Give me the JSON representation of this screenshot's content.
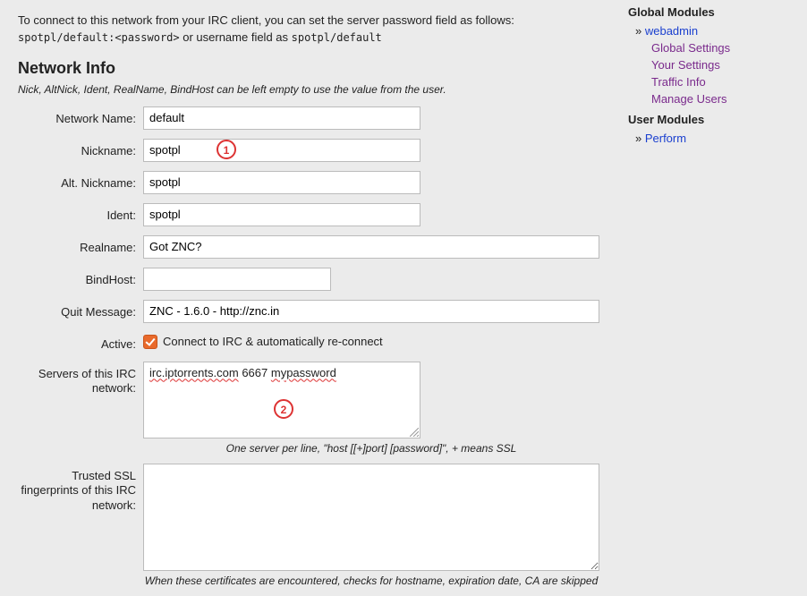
{
  "intro": {
    "before_code1": "To connect to this network from your IRC client, you can set the server password field as follows: ",
    "code1": "spotpl/default:<password>",
    "between": " or username field as ",
    "code2": "spotpl/default"
  },
  "heading": "Network Info",
  "heading_sub": "Nick, AltNick, Ident, RealName, BindHost can be left empty to use the value from the user.",
  "labels": {
    "network_name": "Network Name:",
    "nickname": "Nickname:",
    "alt_nickname": "Alt. Nickname:",
    "ident": "Ident:",
    "realname": "Realname:",
    "bindhost": "BindHost:",
    "quit_message": "Quit Message:",
    "active": "Active:",
    "servers": "Servers of this IRC network:",
    "trusted": "Trusted SSL fingerprints of this IRC network:"
  },
  "values": {
    "network_name": "default",
    "nickname": "spotpl",
    "alt_nickname": "spotpl",
    "ident": "spotpl",
    "realname": "Got ZNC?",
    "bindhost": "",
    "quit_message": "ZNC - 1.6.0 - http://znc.in",
    "active_checked": true,
    "active_label": "Connect to IRC & automatically re-connect",
    "servers_parts": {
      "a": "irc.iptorrents.com",
      "b": " 6667 ",
      "c": "mypassword"
    },
    "trusted": ""
  },
  "notes": {
    "servers": "One server per line, \"host [[+]port] [password]\", + means SSL",
    "trusted": "When these certificates are encountered, checks for hostname, expiration date, CA are skipped"
  },
  "annotations": {
    "one": "1",
    "two": "2"
  },
  "sidebar": {
    "global_modules": "Global Modules",
    "webadmin": "webadmin",
    "global_settings": "Global Settings",
    "your_settings": "Your Settings",
    "traffic_info": "Traffic Info",
    "manage_users": "Manage Users",
    "user_modules": "User Modules",
    "perform": "Perform"
  }
}
